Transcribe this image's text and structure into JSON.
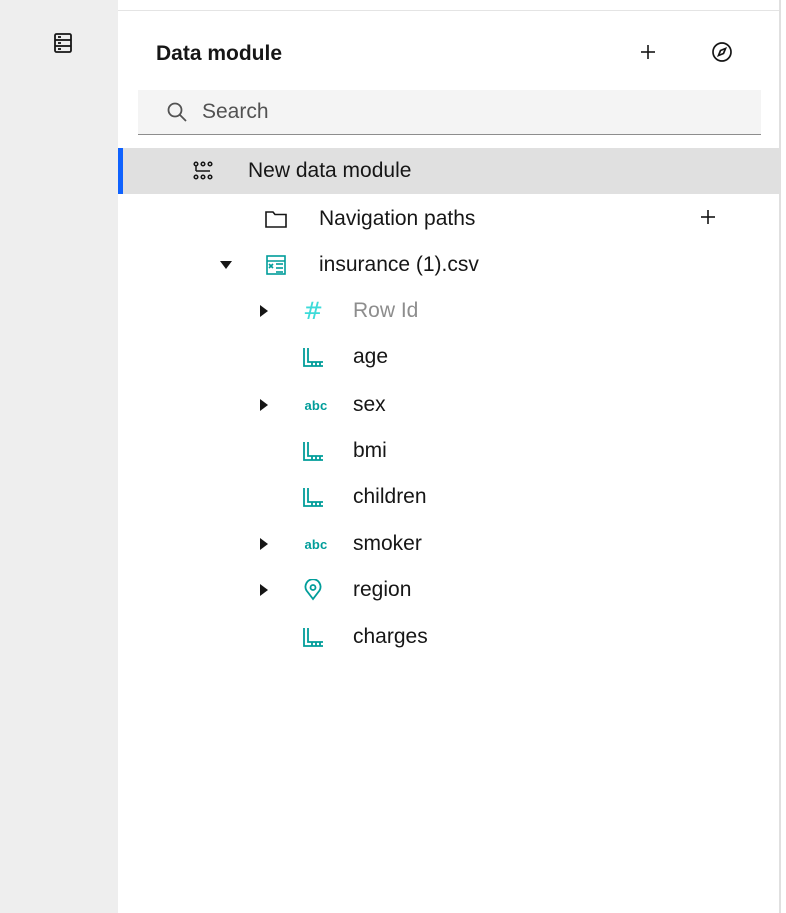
{
  "panel": {
    "title": "Data module",
    "add_icon": "plus-icon",
    "metadata_icon": "compass-icon"
  },
  "search": {
    "placeholder": "Search",
    "value": ""
  },
  "tree": {
    "module": {
      "label": "New data module",
      "icon": "data-module-icon",
      "selected": true
    },
    "nav_paths": {
      "label": "Navigation paths",
      "icon": "folder-icon",
      "add_icon": "plus-icon"
    },
    "table": {
      "label": "insurance (1).csv",
      "icon": "table-icon",
      "expanded": true
    },
    "columns": [
      {
        "label": "Row Id",
        "type": "identifier",
        "icon": "hash-icon",
        "expandable": true,
        "muted": true
      },
      {
        "label": "age",
        "type": "measure",
        "icon": "ruler-icon",
        "expandable": false
      },
      {
        "label": "sex",
        "type": "text",
        "icon": "abc-icon",
        "icon_text": "abc",
        "expandable": true
      },
      {
        "label": "bmi",
        "type": "measure",
        "icon": "ruler-icon",
        "expandable": false
      },
      {
        "label": "children",
        "type": "measure",
        "icon": "ruler-icon",
        "expandable": false
      },
      {
        "label": "smoker",
        "type": "text",
        "icon": "abc-icon",
        "icon_text": "abc",
        "expandable": true
      },
      {
        "label": "region",
        "type": "geo",
        "icon": "location-icon",
        "expandable": true
      },
      {
        "label": "charges",
        "type": "measure",
        "icon": "ruler-icon",
        "expandable": false
      }
    ]
  },
  "colors": {
    "accent": "#0f62fe",
    "teal_icon": "#009d9a",
    "muted_text": "#8d8d8d",
    "selected_bg": "#e0e0e0",
    "rail_bg": "#eeeeee"
  }
}
